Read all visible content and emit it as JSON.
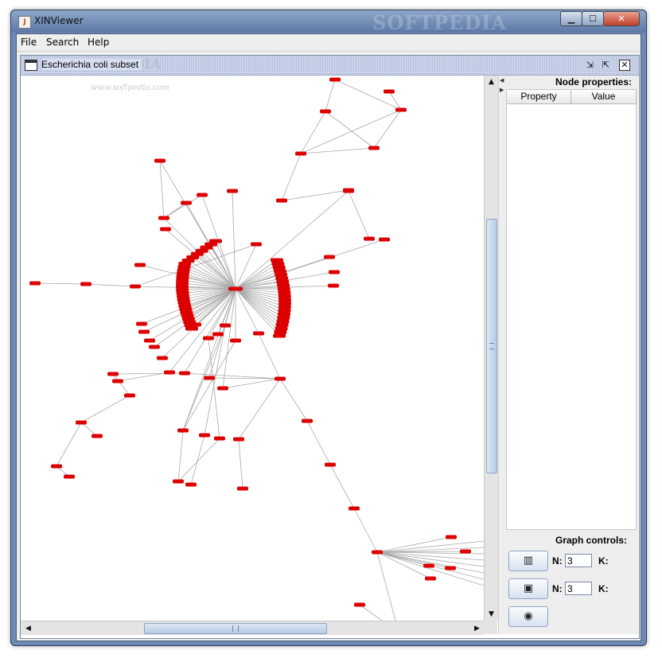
{
  "window": {
    "title": "XINViewer",
    "watermark": "SOFTPEDIA",
    "icon": "java-cup-icon",
    "controls": {
      "minimize": "minimize-icon",
      "maximize": "maximize-icon",
      "close": "close-icon"
    }
  },
  "menubar": {
    "items": [
      "File",
      "Search",
      "Help"
    ]
  },
  "internal_frame": {
    "title": "Escherichia coli subset",
    "watermark": "SOFTPEDIA",
    "canvas_watermark": "www.softpedia.com",
    "controls": {
      "iconify": "iconify-icon",
      "maximize": "maximize-icon",
      "close": "close-icon"
    }
  },
  "node_properties": {
    "title": "Node properties:",
    "columns": [
      "Property",
      "Value"
    ],
    "rows": []
  },
  "graph_controls": {
    "title": "Graph controls:",
    "row1": {
      "button_icon": "column-layout-icon",
      "n_label": "N:",
      "n_value": "3",
      "k_label": "K:"
    },
    "row2": {
      "button_icon": "frame-layout-icon",
      "n_label": "N:",
      "n_value": "3",
      "k_label": "K:"
    },
    "row3": {
      "button_icon": "circle-layout-icon"
    }
  },
  "colors": {
    "node": "#dd0000",
    "edge": "#a8a8a8",
    "window_frame": "#6e8ab4"
  },
  "scroll": {
    "vertical_position": 0.26,
    "horizontal_position": 0.3
  }
}
